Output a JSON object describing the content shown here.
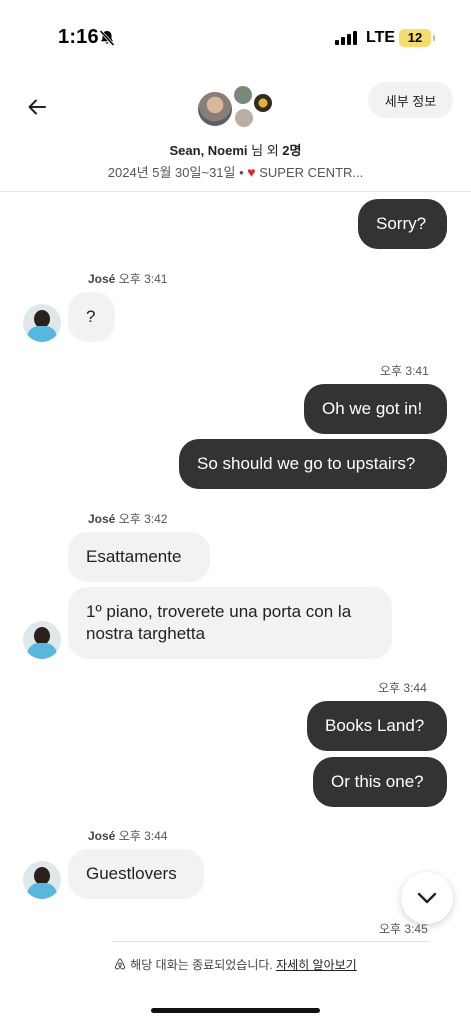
{
  "status_bar": {
    "time": "1:16",
    "network": "LTE",
    "battery": "12"
  },
  "header": {
    "details_label": "세부 정보",
    "participants_bold": "Sean, Noemi",
    "participants_suffix": " 님 외 ",
    "participants_count": "2명",
    "subtitle_dates": "2024년 5월 30일~31일 • ",
    "subtitle_place": "SUPER CENTR..."
  },
  "messages": {
    "m1": "Sorry?",
    "g1_sender": "José",
    "g1_time": " 오후 3:41",
    "m2": "?",
    "g2_time": "오후 3:41",
    "m3": "Oh we got in!",
    "m4": "So should we go to upstairs?",
    "g3_sender": "José",
    "g3_time": " 오후 3:42",
    "m5": "Esattamente",
    "m6_line1": "1º piano, troverete una porta con la",
    "m6_line2": "nostra targhetta",
    "g4_time": "오후 3:44",
    "m7": "Books Land?",
    "m8": "Or this one?",
    "g5_sender": "José",
    "g5_time": " 오후 3:44",
    "m9": "Guestlovers",
    "g6_time": "오후 3:45"
  },
  "footer": {
    "ended_text": "해당 대화는 종료되었습니다. ",
    "learn_more": "자세히 알아보기"
  },
  "icons": {
    "bell": "bell-slash-icon",
    "back": "arrow-left-icon",
    "scroll": "chevron-down-icon",
    "airbnb": "airbnb-logo-icon"
  }
}
